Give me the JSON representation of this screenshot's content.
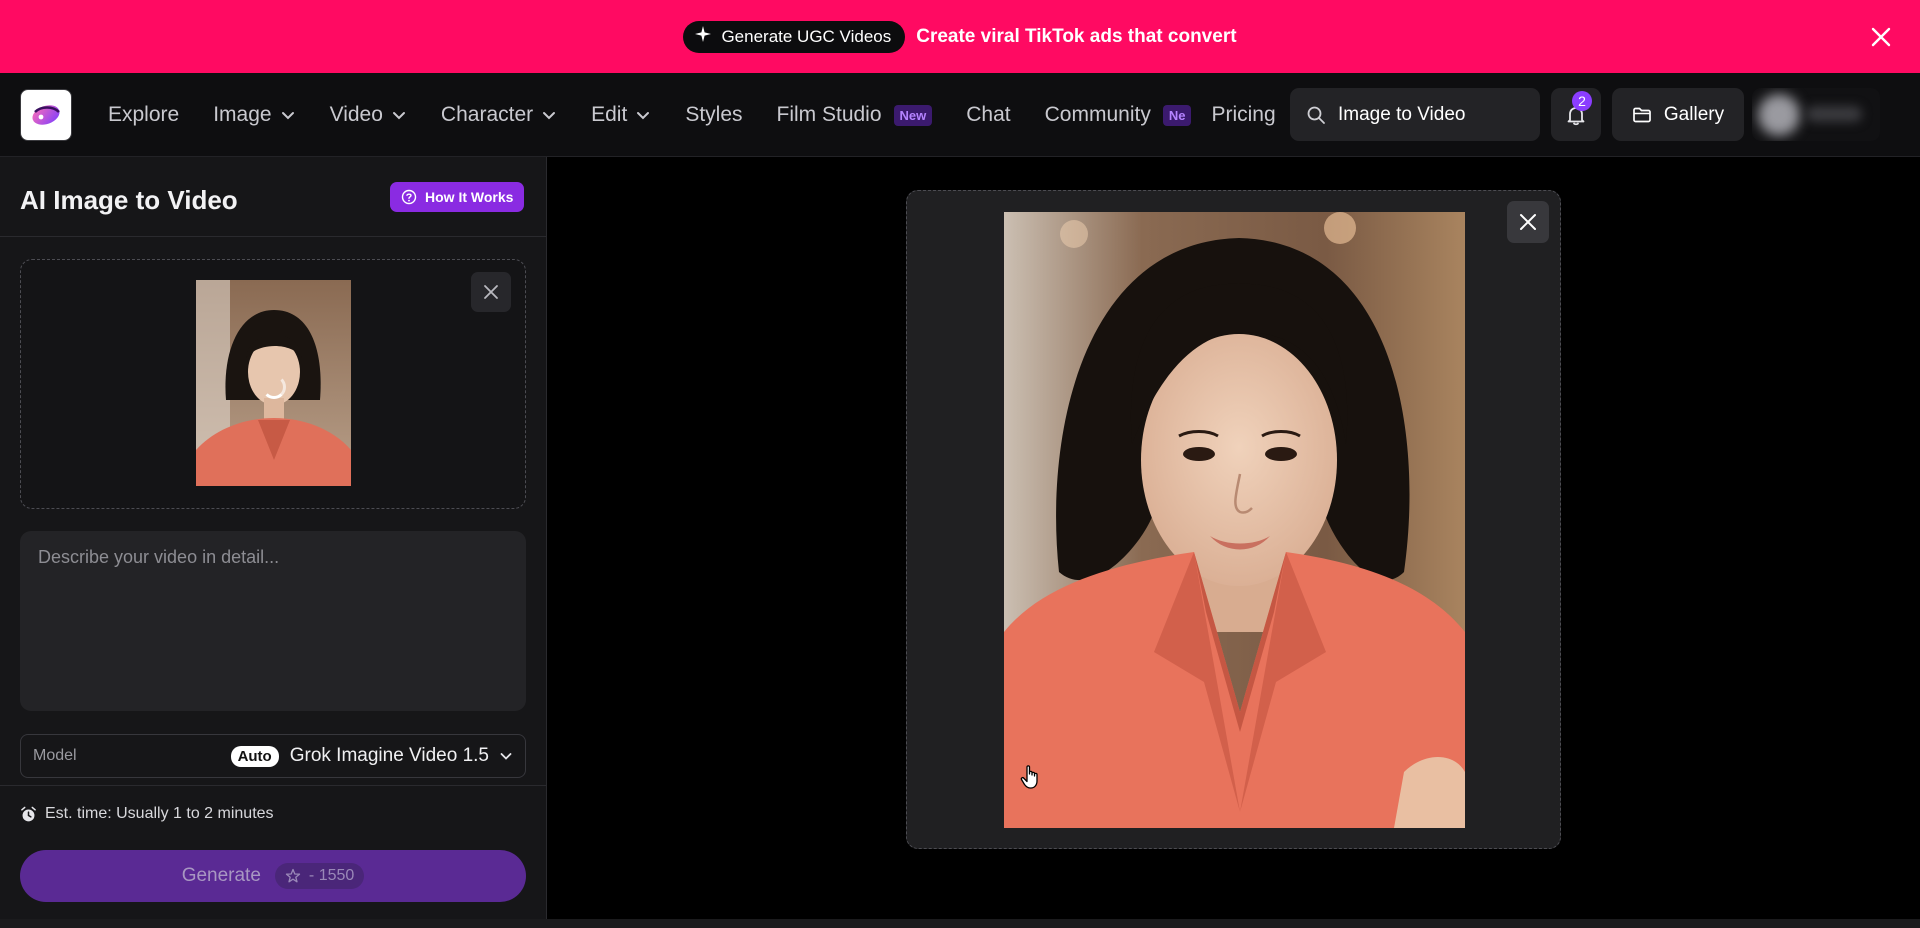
{
  "banner": {
    "pill_label": "Generate UGC Videos",
    "headline": "Create viral TikTok ads that convert"
  },
  "nav": {
    "items": [
      {
        "label": "Explore",
        "dropdown": false
      },
      {
        "label": "Image",
        "dropdown": true
      },
      {
        "label": "Video",
        "dropdown": true
      },
      {
        "label": "Character",
        "dropdown": true
      },
      {
        "label": "Edit",
        "dropdown": true
      },
      {
        "label": "Styles",
        "dropdown": false
      },
      {
        "label": "Film Studio",
        "badge": "New"
      },
      {
        "label": "Chat",
        "dropdown": false
      },
      {
        "label": "Community",
        "badge": "Ne"
      },
      {
        "label": "Pricing",
        "dropdown": false
      }
    ],
    "search_value": "Image to Video",
    "notification_count": "2",
    "gallery_label": "Gallery"
  },
  "panel": {
    "title": "AI Image to Video",
    "how_it_works": "How It Works",
    "prompt_placeholder": "Describe your video in detail...",
    "model_label": "Model",
    "model_auto": "Auto",
    "model_name": "Grok Imagine Video 1.5",
    "est_time": "Est. time: Usually 1 to 2 minutes",
    "generate_label": "Generate",
    "generate_cost": "- 1550"
  },
  "colors": {
    "banner": "#ff0a62",
    "accent": "#8a2be2",
    "generate_bg": "#5a2a94",
    "blazer": "#e8735c"
  }
}
